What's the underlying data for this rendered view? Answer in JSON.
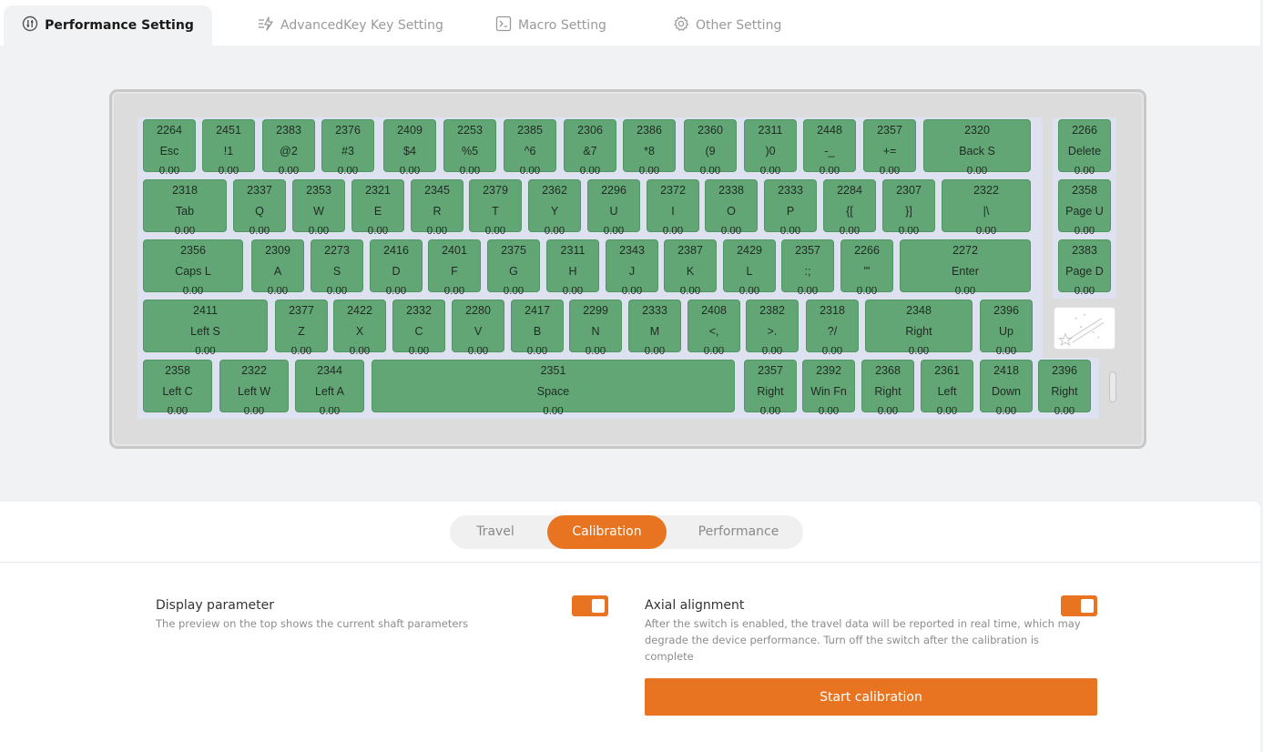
{
  "colors": {
    "accent": "#e87421",
    "key_green": "#62a676",
    "plate": "#dde1f0"
  },
  "tabs": [
    {
      "label": "Performance Setting",
      "icon": "performance-icon",
      "active": true
    },
    {
      "label": "AdvancedKey Key Setting",
      "icon": "bolt-icon",
      "active": false
    },
    {
      "label": "Macro Setting",
      "icon": "terminal-icon",
      "active": false
    },
    {
      "label": "Other Setting",
      "icon": "gear-icon",
      "active": false
    }
  ],
  "keyboard": {
    "keys": [
      {
        "value": "2264",
        "label": "Esc",
        "travel": "0.00"
      },
      {
        "value": "2451",
        "label": "!1",
        "travel": "0.00"
      },
      {
        "value": "2383",
        "label": "@2",
        "travel": "0.00"
      },
      {
        "value": "2376",
        "label": "#3",
        "travel": "0.00"
      },
      {
        "value": "2409",
        "label": "$4",
        "travel": "0.00"
      },
      {
        "value": "2253",
        "label": "%5",
        "travel": "0.00"
      },
      {
        "value": "2385",
        "label": "^6",
        "travel": "0.00"
      },
      {
        "value": "2306",
        "label": "&7",
        "travel": "0.00"
      },
      {
        "value": "2386",
        "label": "*8",
        "travel": "0.00"
      },
      {
        "value": "2360",
        "label": "(9",
        "travel": "0.00"
      },
      {
        "value": "2311",
        "label": ")0",
        "travel": "0.00"
      },
      {
        "value": "2448",
        "label": "-_",
        "travel": "0.00"
      },
      {
        "value": "2357",
        "label": "+=",
        "travel": "0.00"
      },
      {
        "value": "2320",
        "label": "Back S",
        "travel": "0.00"
      },
      {
        "value": "2266",
        "label": "Delete",
        "travel": "0.00"
      },
      {
        "value": "2318",
        "label": "Tab",
        "travel": "0.00"
      },
      {
        "value": "2337",
        "label": "Q",
        "travel": "0.00"
      },
      {
        "value": "2353",
        "label": "W",
        "travel": "0.00"
      },
      {
        "value": "2321",
        "label": "E",
        "travel": "0.00"
      },
      {
        "value": "2345",
        "label": "R",
        "travel": "0.00"
      },
      {
        "value": "2379",
        "label": "T",
        "travel": "0.00"
      },
      {
        "value": "2362",
        "label": "Y",
        "travel": "0.00"
      },
      {
        "value": "2296",
        "label": "U",
        "travel": "0.00"
      },
      {
        "value": "2372",
        "label": "I",
        "travel": "0.00"
      },
      {
        "value": "2338",
        "label": "O",
        "travel": "0.00"
      },
      {
        "value": "2333",
        "label": "P",
        "travel": "0.00"
      },
      {
        "value": "2284",
        "label": "{[",
        "travel": "0.00"
      },
      {
        "value": "2307",
        "label": "}]",
        "travel": "0.00"
      },
      {
        "value": "2322",
        "label": "|\\",
        "travel": "0.00"
      },
      {
        "value": "2358",
        "label": "Page U",
        "travel": "0.00"
      },
      {
        "value": "2356",
        "label": "Caps L",
        "travel": "0.00"
      },
      {
        "value": "2309",
        "label": "A",
        "travel": "0.00"
      },
      {
        "value": "2273",
        "label": "S",
        "travel": "0.00"
      },
      {
        "value": "2416",
        "label": "D",
        "travel": "0.00"
      },
      {
        "value": "2401",
        "label": "F",
        "travel": "0.00"
      },
      {
        "value": "2375",
        "label": "G",
        "travel": "0.00"
      },
      {
        "value": "2311",
        "label": "H",
        "travel": "0.00"
      },
      {
        "value": "2343",
        "label": "J",
        "travel": "0.00"
      },
      {
        "value": "2387",
        "label": "K",
        "travel": "0.00"
      },
      {
        "value": "2429",
        "label": "L",
        "travel": "0.00"
      },
      {
        "value": "2357",
        "label": ":;",
        "travel": "0.00"
      },
      {
        "value": "2266",
        "label": "\"'",
        "travel": "0.00"
      },
      {
        "value": "2272",
        "label": "Enter",
        "travel": "0.00"
      },
      {
        "value": "2383",
        "label": "Page D",
        "travel": "0.00"
      },
      {
        "value": "2411",
        "label": "Left S",
        "travel": "0.00"
      },
      {
        "value": "2377",
        "label": "Z",
        "travel": "0.00"
      },
      {
        "value": "2422",
        "label": "X",
        "travel": "0.00"
      },
      {
        "value": "2332",
        "label": "C",
        "travel": "0.00"
      },
      {
        "value": "2280",
        "label": "V",
        "travel": "0.00"
      },
      {
        "value": "2417",
        "label": "B",
        "travel": "0.00"
      },
      {
        "value": "2299",
        "label": "N",
        "travel": "0.00"
      },
      {
        "value": "2333",
        "label": "M",
        "travel": "0.00"
      },
      {
        "value": "2408",
        "label": "<,",
        "travel": "0.00"
      },
      {
        "value": "2382",
        "label": ">.",
        "travel": "0.00"
      },
      {
        "value": "2318",
        "label": "?/",
        "travel": "0.00"
      },
      {
        "value": "2348",
        "label": "Right",
        "travel": "0.00"
      },
      {
        "value": "2396",
        "label": "Up",
        "travel": "0.00"
      },
      {
        "value": "2358",
        "label": "Left C",
        "travel": "0.00"
      },
      {
        "value": "2322",
        "label": "Left W",
        "travel": "0.00"
      },
      {
        "value": "2344",
        "label": "Left A",
        "travel": "0.00"
      },
      {
        "value": "2351",
        "label": "Space",
        "travel": "0.00"
      },
      {
        "value": "2357",
        "label": "Right",
        "travel": "0.00"
      },
      {
        "value": "2392",
        "label": "Win Fn",
        "travel": "0.00"
      },
      {
        "value": "2368",
        "label": "Right",
        "travel": "0.00"
      },
      {
        "value": "2361",
        "label": "Left",
        "travel": "0.00"
      },
      {
        "value": "2418",
        "label": "Down",
        "travel": "0.00"
      },
      {
        "value": "2396",
        "label": "Right",
        "travel": "0.00"
      }
    ]
  },
  "subtabs": [
    {
      "label": "Travel",
      "active": false
    },
    {
      "label": "Calibration",
      "active": true
    },
    {
      "label": "Performance",
      "active": false
    }
  ],
  "settings": {
    "display": {
      "title": "Display parameter",
      "desc": "The preview on the top shows the current shaft parameters",
      "enabled": true
    },
    "axial": {
      "title": "Axial alignment",
      "desc_lines": [
        "After the switch is enabled, the travel data will be reported in real time, which may",
        "degrade the device performance. Turn off the switch after the calibration is",
        "complete"
      ],
      "enabled": true
    },
    "start_button": "Start calibration"
  }
}
